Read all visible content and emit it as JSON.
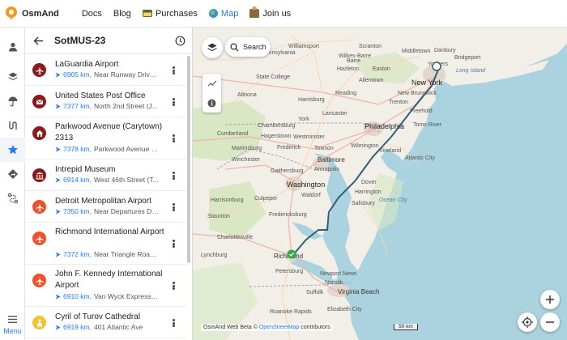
{
  "app": {
    "brand": "OsmAnd"
  },
  "nav": [
    {
      "label": "Docs",
      "icon": "",
      "active": false
    },
    {
      "label": "Blog",
      "icon": "",
      "active": false
    },
    {
      "label": "Purchases",
      "icon": "purchases-icon",
      "active": false
    },
    {
      "label": "Map",
      "icon": "globe-icon",
      "active": true
    },
    {
      "label": "Join us",
      "icon": "join-icon",
      "active": false
    }
  ],
  "rail": {
    "menu_label": "Menu"
  },
  "panel": {
    "title": "SotMUS-23",
    "items": [
      {
        "name": "LaGuardia Airport",
        "distance": "6905 km,",
        "address": "Near Runway Drive, ...",
        "icon": "airplane-icon",
        "color": "#8b1a1a"
      },
      {
        "name": "United States Post Office",
        "distance": "7377 km,",
        "address": "North 2nd Street (J...",
        "icon": "mailbox-icon",
        "color": "#8b1a1a"
      },
      {
        "name": "Parkwood Avenue (Carytown) 2313",
        "distance": "7378 km,",
        "address": "Parkwood Avenue (...",
        "icon": "home-icon",
        "color": "#8b1a1a"
      },
      {
        "name": "Intrepid Museum",
        "distance": "6914 km,",
        "address": "West 46th Street (T...",
        "icon": "museum-icon",
        "color": "#8b1a1a"
      },
      {
        "name": "Detroit Metropolitan Airport",
        "distance": "7350 km,",
        "address": "Near Departures DT...",
        "icon": "airplane-icon",
        "color": "#f0502a"
      },
      {
        "name": "Richmond International Airport",
        "distance": "7372 km,",
        "address": "Near Triangle Road,...",
        "icon": "airplane-icon",
        "color": "#f0502a"
      },
      {
        "name": "John F. Kennedy International Airport",
        "distance": "6910 km,",
        "address": "Van Wyck Expressw...",
        "icon": "airplane-icon",
        "color": "#f0502a"
      },
      {
        "name": "Cyril of Turov Cathedral",
        "distance": "6919 km,",
        "address": "401 Atlantic Ave",
        "icon": "church-icon",
        "color": "#f2c230"
      }
    ]
  },
  "map": {
    "search_label": "Search",
    "attribution": "OsmAnd Web Beta ©",
    "attribution_link": "OpenStreetMap",
    "attribution_suffix": "contributors",
    "scale_label": "50 km",
    "labels": {
      "new_york": "New York",
      "philadelphia": "Philadelphia",
      "baltimore": "Baltimore",
      "washington": "Washington",
      "richmond": "Richmond",
      "virginia_beach": "Virginia Beach",
      "newport_news": "Newport News",
      "norfolk": "Norfolk",
      "allentown": "Allentown",
      "harrisburg": "Harrisburg",
      "lancaster": "Lancaster",
      "trenton": "Trenton",
      "wilmington": "Wilmington",
      "dover": "Dover",
      "annapolis": "Annapolis",
      "fredericksburg": "Fredericksburg",
      "hagerstown": "Hagerstown",
      "frederick": "Frederick",
      "winchester": "Winchester",
      "charlottesville": "Charlottesville",
      "lynchburg": "Lynchburg",
      "petersburg": "Petersburg",
      "salisbury": "Salisbury",
      "ocean_city": "Ocean City",
      "atlantic_city": "Atlantic City",
      "vineland": "Vineland",
      "toms_river": "Toms River",
      "long_island": "Long Island",
      "bridgeport": "Bridgeport",
      "danbury": "Danbury",
      "yonkers": "Yonkers",
      "scranton": "Scranton",
      "wilkes_barre": "Wilkes-Barre",
      "hazleton": "Hazleton",
      "reading": "Reading",
      "york": "York",
      "pennsylvania": "Pennsylvania",
      "state_college": "State College",
      "williamsport": "Williamsport",
      "altoona": "Altoona",
      "middletown": "Middletown",
      "barre": "Barre",
      "chambersburg": "Chambersburg",
      "cumberland": "Cumberland",
      "westminster": "Westminster",
      "martinsburg": "Martinsburg",
      "towson": "Towson",
      "gaithersburg": "Gaithersburg",
      "waldorf": "Waldorf",
      "culpeper": "Culpeper",
      "harrisonburg": "Harrisonburg",
      "staunton": "Staunton",
      "elizabeth_city": "Elizabeth City",
      "roanoke_rapids": "Roanoke Rapids",
      "suffolk": "Suffolk",
      "new_brunswick": "New Brunswick",
      "freehold": "Freehold",
      "easton": "Easton",
      "harrington": "Harrington"
    }
  }
}
